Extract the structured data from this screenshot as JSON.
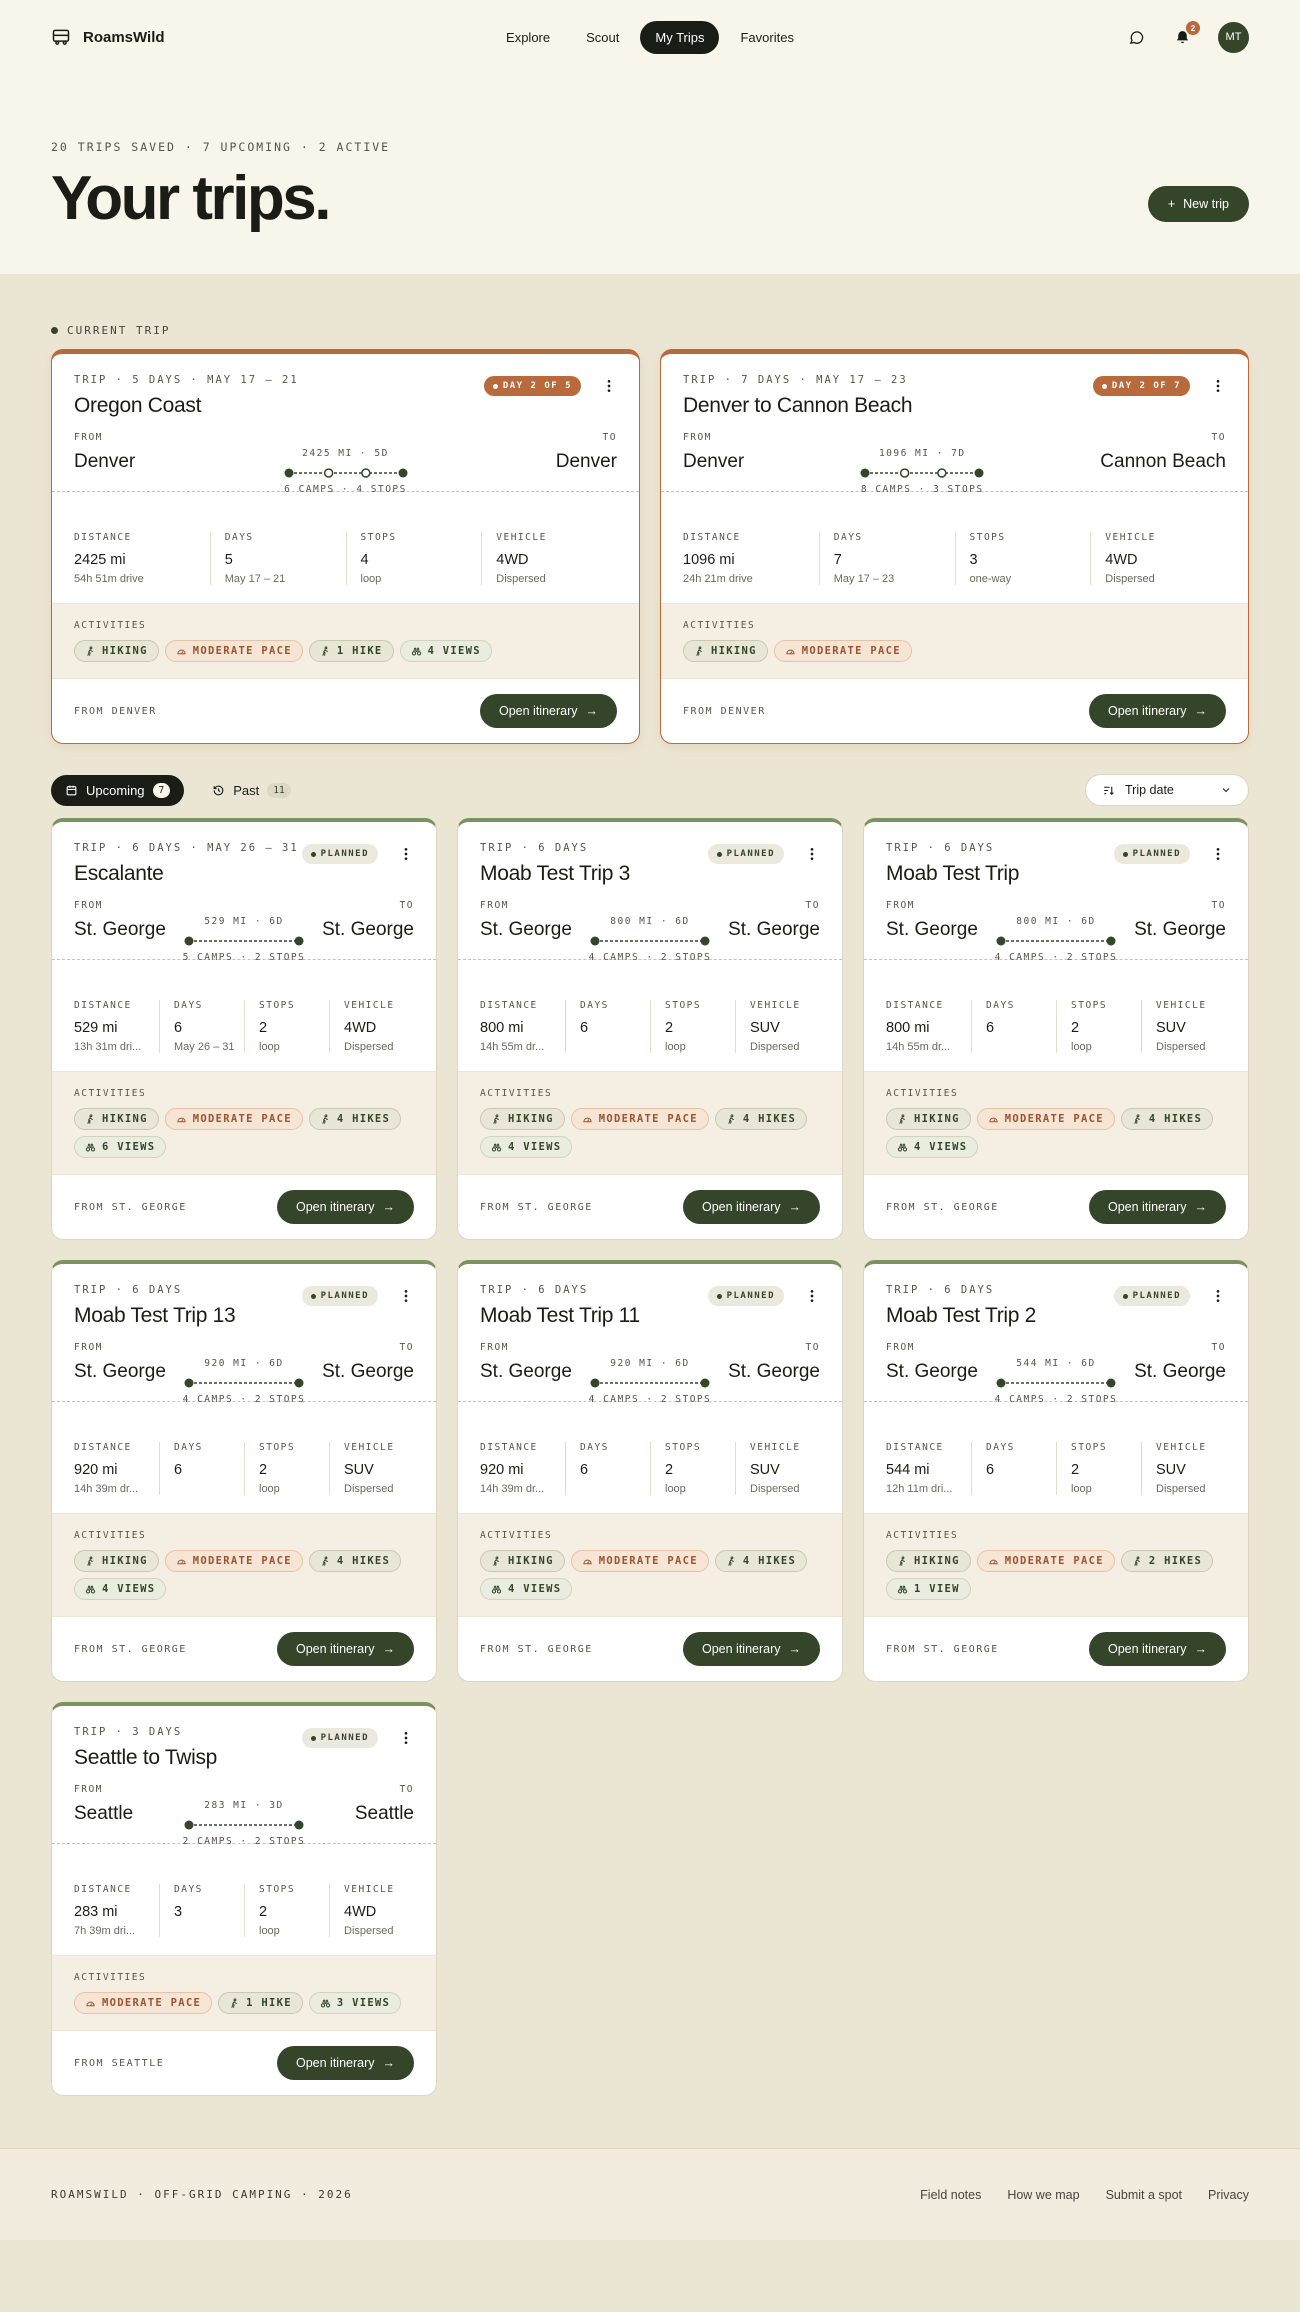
{
  "brand": {
    "name": "RoamsWild"
  },
  "nav": {
    "links": [
      "Explore",
      "Scout",
      "My Trips",
      "Favorites"
    ],
    "active_index": 2,
    "notif_count": "2",
    "avatar_initials": "MT"
  },
  "hero": {
    "stats": "20 TRIPS SAVED · 7 UPCOMING · 2 ACTIVE",
    "title": "Your trips.",
    "new_trip_label": "New trip"
  },
  "labels": {
    "current_trip": "CURRENT TRIP",
    "from": "FROM",
    "to": "TO",
    "distance": "DISTANCE",
    "days": "DAYS",
    "stops": "STOPS",
    "vehicle": "VEHICLE",
    "activities": "ACTIVITIES",
    "open_itinerary": "Open itinerary"
  },
  "current_trips": [
    {
      "meta": "TRIP · 5 DAYS · MAY 17 – 21",
      "title": "Oregon Coast",
      "status": "DAY 2 OF 5",
      "from": "Denver",
      "to": "Denver",
      "route_dist": "2425 MI · 5D",
      "route_summary": "6 CAMPS · 4 STOPS",
      "distance": "2425 mi",
      "distance_sub": "54h 51m drive",
      "days": "5",
      "days_sub": "May 17 – 21",
      "stops": "4",
      "stops_sub": "loop",
      "vehicle": "4WD",
      "vehicle_sub": "Dispersed",
      "activities": [
        {
          "type": "hike",
          "label": "HIKING"
        },
        {
          "type": "pace",
          "label": "MODERATE PACE"
        },
        {
          "type": "hike",
          "label": "1 HIKE"
        },
        {
          "type": "view",
          "label": "4 VIEWS"
        }
      ],
      "footer": "FROM DENVER"
    },
    {
      "meta": "TRIP · 7 DAYS · MAY 17 – 23",
      "title": "Denver to Cannon Beach",
      "status": "DAY 2 OF 7",
      "from": "Denver",
      "to": "Cannon Beach",
      "route_dist": "1096 MI · 7D",
      "route_summary": "8 CAMPS · 3 STOPS",
      "distance": "1096 mi",
      "distance_sub": "24h 21m drive",
      "days": "7",
      "days_sub": "May 17 – 23",
      "stops": "3",
      "stops_sub": "one-way",
      "vehicle": "4WD",
      "vehicle_sub": "Dispersed",
      "activities": [
        {
          "type": "hike",
          "label": "HIKING"
        },
        {
          "type": "pace",
          "label": "MODERATE PACE"
        }
      ],
      "footer": "FROM DENVER"
    }
  ],
  "tabs": [
    {
      "label": "Upcoming",
      "count": "7"
    },
    {
      "label": "Past",
      "count": "11"
    }
  ],
  "sort": {
    "label": "Trip date"
  },
  "upcoming_trips": [
    {
      "meta": "TRIP · 6 DAYS · MAY 26 – 31",
      "title": "Escalante",
      "status": "PLANNED",
      "from": "St. George",
      "to": "St. George",
      "route_dist": "529 MI · 6D",
      "route_summary": "5 CAMPS · 2 STOPS",
      "distance": "529 mi",
      "distance_sub": "13h 31m dri...",
      "days": "6",
      "days_sub": "May 26 – 31",
      "stops": "2",
      "stops_sub": "loop",
      "vehicle": "4WD",
      "vehicle_sub": "Dispersed",
      "activities": [
        {
          "type": "hike",
          "label": "HIKING"
        },
        {
          "type": "pace",
          "label": "MODERATE PACE"
        },
        {
          "type": "hike",
          "label": "4 HIKES"
        },
        {
          "type": "view",
          "label": "6 VIEWS"
        }
      ],
      "footer": "FROM ST. GEORGE"
    },
    {
      "meta": "TRIP · 6 DAYS",
      "title": "Moab Test Trip 3",
      "status": "PLANNED",
      "from": "St. George",
      "to": "St. George",
      "route_dist": "800 MI · 6D",
      "route_summary": "4 CAMPS · 2 STOPS",
      "distance": "800 mi",
      "distance_sub": "14h 55m dr...",
      "days": "6",
      "days_sub": "",
      "stops": "2",
      "stops_sub": "loop",
      "vehicle": "SUV",
      "vehicle_sub": "Dispersed",
      "activities": [
        {
          "type": "hike",
          "label": "HIKING"
        },
        {
          "type": "pace",
          "label": "MODERATE PACE"
        },
        {
          "type": "hike",
          "label": "4 HIKES"
        },
        {
          "type": "view",
          "label": "4 VIEWS"
        }
      ],
      "footer": "FROM ST. GEORGE"
    },
    {
      "meta": "TRIP · 6 DAYS",
      "title": "Moab Test Trip",
      "status": "PLANNED",
      "from": "St. George",
      "to": "St. George",
      "route_dist": "800 MI · 6D",
      "route_summary": "4 CAMPS · 2 STOPS",
      "distance": "800 mi",
      "distance_sub": "14h 55m dr...",
      "days": "6",
      "days_sub": "",
      "stops": "2",
      "stops_sub": "loop",
      "vehicle": "SUV",
      "vehicle_sub": "Dispersed",
      "activities": [
        {
          "type": "hike",
          "label": "HIKING"
        },
        {
          "type": "pace",
          "label": "MODERATE PACE"
        },
        {
          "type": "hike",
          "label": "4 HIKES"
        },
        {
          "type": "view",
          "label": "4 VIEWS"
        }
      ],
      "footer": "FROM ST. GEORGE"
    },
    {
      "meta": "TRIP · 6 DAYS",
      "title": "Moab Test Trip 13",
      "status": "PLANNED",
      "from": "St. George",
      "to": "St. George",
      "route_dist": "920 MI · 6D",
      "route_summary": "4 CAMPS · 2 STOPS",
      "distance": "920 mi",
      "distance_sub": "14h 39m dr...",
      "days": "6",
      "days_sub": "",
      "stops": "2",
      "stops_sub": "loop",
      "vehicle": "SUV",
      "vehicle_sub": "Dispersed",
      "activities": [
        {
          "type": "hike",
          "label": "HIKING"
        },
        {
          "type": "pace",
          "label": "MODERATE PACE"
        },
        {
          "type": "hike",
          "label": "4 HIKES"
        },
        {
          "type": "view",
          "label": "4 VIEWS"
        }
      ],
      "footer": "FROM ST. GEORGE"
    },
    {
      "meta": "TRIP · 6 DAYS",
      "title": "Moab Test Trip 11",
      "status": "PLANNED",
      "from": "St. George",
      "to": "St. George",
      "route_dist": "920 MI · 6D",
      "route_summary": "4 CAMPS · 2 STOPS",
      "distance": "920 mi",
      "distance_sub": "14h 39m dr...",
      "days": "6",
      "days_sub": "",
      "stops": "2",
      "stops_sub": "loop",
      "vehicle": "SUV",
      "vehicle_sub": "Dispersed",
      "activities": [
        {
          "type": "hike",
          "label": "HIKING"
        },
        {
          "type": "pace",
          "label": "MODERATE PACE"
        },
        {
          "type": "hike",
          "label": "4 HIKES"
        },
        {
          "type": "view",
          "label": "4 VIEWS"
        }
      ],
      "footer": "FROM ST. GEORGE"
    },
    {
      "meta": "TRIP · 6 DAYS",
      "title": "Moab Test Trip 2",
      "status": "PLANNED",
      "from": "St. George",
      "to": "St. George",
      "route_dist": "544 MI · 6D",
      "route_summary": "4 CAMPS · 2 STOPS",
      "distance": "544 mi",
      "distance_sub": "12h 11m dri...",
      "days": "6",
      "days_sub": "",
      "stops": "2",
      "stops_sub": "loop",
      "vehicle": "SUV",
      "vehicle_sub": "Dispersed",
      "activities": [
        {
          "type": "hike",
          "label": "HIKING"
        },
        {
          "type": "pace",
          "label": "MODERATE PACE"
        },
        {
          "type": "hike",
          "label": "2 HIKES"
        },
        {
          "type": "view",
          "label": "1 VIEW"
        }
      ],
      "footer": "FROM ST. GEORGE"
    },
    {
      "meta": "TRIP · 3 DAYS",
      "title": "Seattle to Twisp",
      "status": "PLANNED",
      "from": "Seattle",
      "to": "Seattle",
      "route_dist": "283 MI · 3D",
      "route_summary": "2 CAMPS · 2 STOPS",
      "distance": "283 mi",
      "distance_sub": "7h 39m dri...",
      "days": "3",
      "days_sub": "",
      "stops": "2",
      "stops_sub": "loop",
      "vehicle": "4WD",
      "vehicle_sub": "Dispersed",
      "activities": [
        {
          "type": "pace",
          "label": "MODERATE PACE"
        },
        {
          "type": "hike",
          "label": "1 HIKE"
        },
        {
          "type": "view",
          "label": "3 VIEWS"
        }
      ],
      "footer": "FROM SEATTLE"
    }
  ],
  "footer": {
    "copy": "ROAMSWILD · OFF-GRID CAMPING · 2026",
    "links": [
      "Field notes",
      "How we map",
      "Submit a spot",
      "Privacy"
    ]
  },
  "colors": {
    "accent": "#34452a",
    "active": "#b86a3c",
    "background": "#ebe6d3"
  }
}
